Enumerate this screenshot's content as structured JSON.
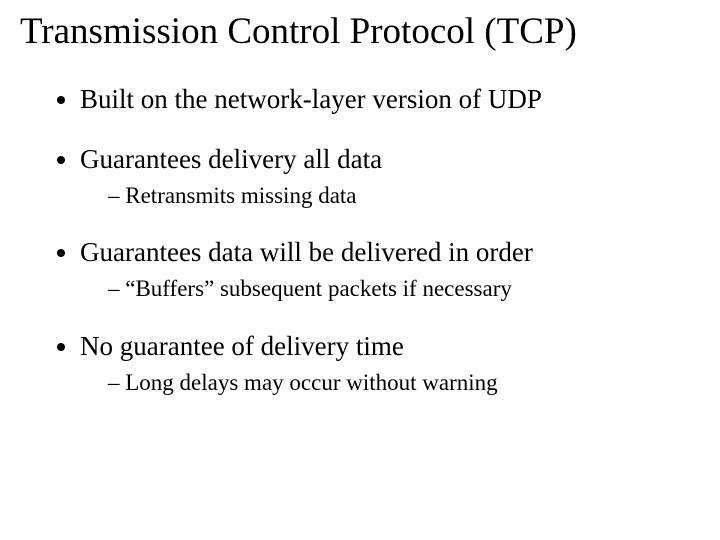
{
  "title": "Transmission Control Protocol (TCP)",
  "bullets": {
    "b1": "Built on the network-layer version of UDP",
    "b2": "Guarantees delivery all data",
    "b2_sub1": "Retransmits missing data",
    "b3": "Guarantees data will be delivered in order",
    "b3_sub1": "“Buffers” subsequent packets if necessary",
    "b4": "No guarantee of delivery time",
    "b4_sub1": "Long delays may occur without warning"
  }
}
